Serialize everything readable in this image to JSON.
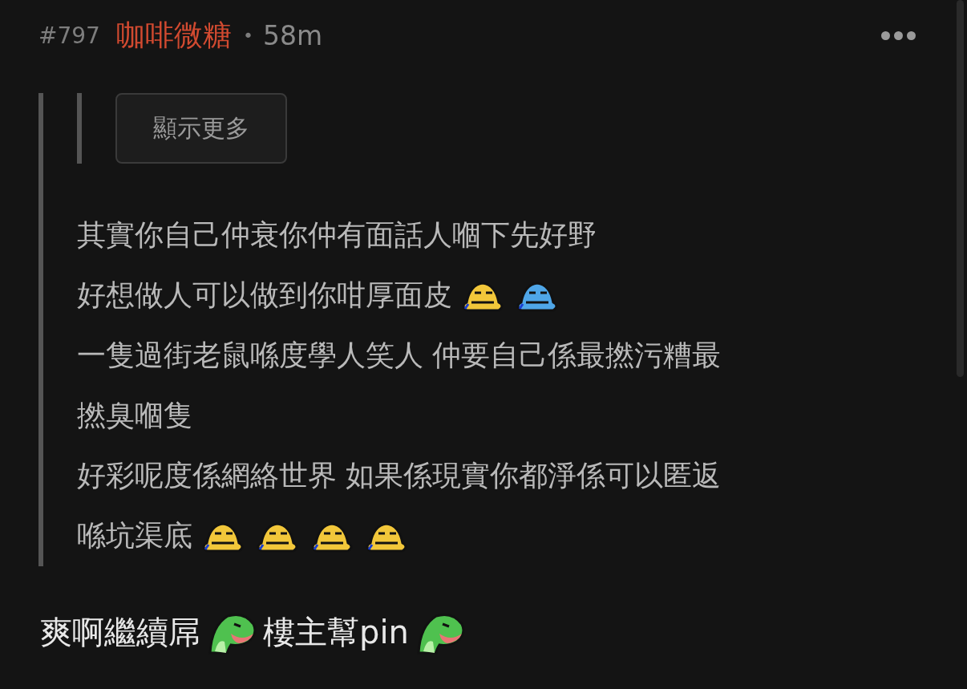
{
  "post": {
    "floor": "#797",
    "author": "咖啡微糖",
    "separator": "•",
    "time": "58m"
  },
  "quote": {
    "show_more": "顯示更多",
    "lines": [
      {
        "segments": [
          {
            "kind": "text",
            "text": "其實你自己仲衰你仲有面話人嗰下先好野"
          }
        ]
      },
      {
        "segments": [
          {
            "kind": "text",
            "text": "好想做人可以做到你咁厚面皮"
          },
          {
            "kind": "face",
            "color": "#f2c73a"
          },
          {
            "kind": "face",
            "color": "#4fa6e8"
          }
        ]
      },
      {
        "segments": [
          {
            "kind": "text",
            "text": "一隻過街老鼠喺度學人笑人 仲要自己係最撚污糟最"
          }
        ]
      },
      {
        "segments": [
          {
            "kind": "text",
            "text": "撚臭嗰隻"
          }
        ]
      },
      {
        "segments": [
          {
            "kind": "text",
            "text": "好彩呢度係網絡世界 如果係現實你都淨係可以匿返"
          }
        ]
      },
      {
        "segments": [
          {
            "kind": "text",
            "text": "喺坑渠底"
          },
          {
            "kind": "face",
            "color": "#f2c73a"
          },
          {
            "kind": "face",
            "color": "#f2c73a"
          },
          {
            "kind": "face",
            "color": "#f2c73a"
          },
          {
            "kind": "face",
            "color": "#f2c73a"
          }
        ]
      }
    ]
  },
  "reply": {
    "segments": [
      {
        "kind": "text",
        "text": "爽啊繼續屌"
      },
      {
        "kind": "dino"
      },
      {
        "kind": "text",
        "text": "樓主幫pin"
      },
      {
        "kind": "dino"
      }
    ]
  }
}
